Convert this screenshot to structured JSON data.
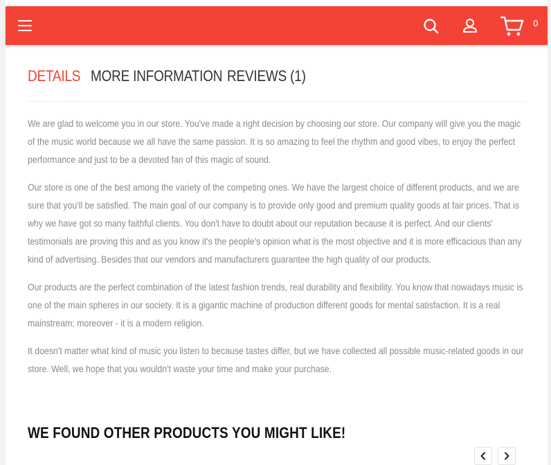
{
  "header": {
    "menu_icon": "hamburger-icon",
    "search_icon": "search-icon",
    "account_icon": "user-icon",
    "cart_icon": "cart-icon",
    "cart_count": "0",
    "accent_color": "#f44336"
  },
  "tabs": [
    {
      "label": "DETAILS",
      "active": true
    },
    {
      "label": "MORE INFORMATION",
      "active": false
    },
    {
      "label": "REVIEWS (1)",
      "active": false
    }
  ],
  "description": {
    "paragraphs": [
      "We are glad to welcome you in our store. You've made a right decision by choosing our store. Our company will give you the magic of the music world because we all have the same passion. It is so amazing to feel the rhythm and good vibes, to enjoy the perfect performance and just to be a devoted fan of this magic of sound.",
      "Our store is one of the best among the variety of the competing ones. We have the largest choice of different products, and we are sure that you'll be satisfied. The main goal of our company is to provide only good and premium quality goods at fair prices. That is why we have got so many faithful clients. You don't have to doubt about our reputation because it is perfect. And our clients' testimonials are proving this and as you know it's the people's opinion what is the most objective and it is more efficacious than any kind of advertising. Besides that our vendors and manufacturers guarantee the high quality of our products.",
      "Our products are the perfect combination of the latest fashion trends, real durability and flexibility. You know that nowadays music is one of the main spheres in our society. It is a gigantic machine of production different goods for mental satisfaction. It is a real mainstream; moreover - it is a modern religion.",
      "It doesn't matter what kind of music you listen to because tastes differ, but we have collected all possible music-related goods in our store. Well, we hope that you wouldn't waste your time and make your purchase."
    ]
  },
  "related": {
    "title": "WE FOUND OTHER PRODUCTS YOU MIGHT LIKE!",
    "prev_icon": "chevron-left-icon",
    "next_icon": "chevron-right-icon"
  }
}
